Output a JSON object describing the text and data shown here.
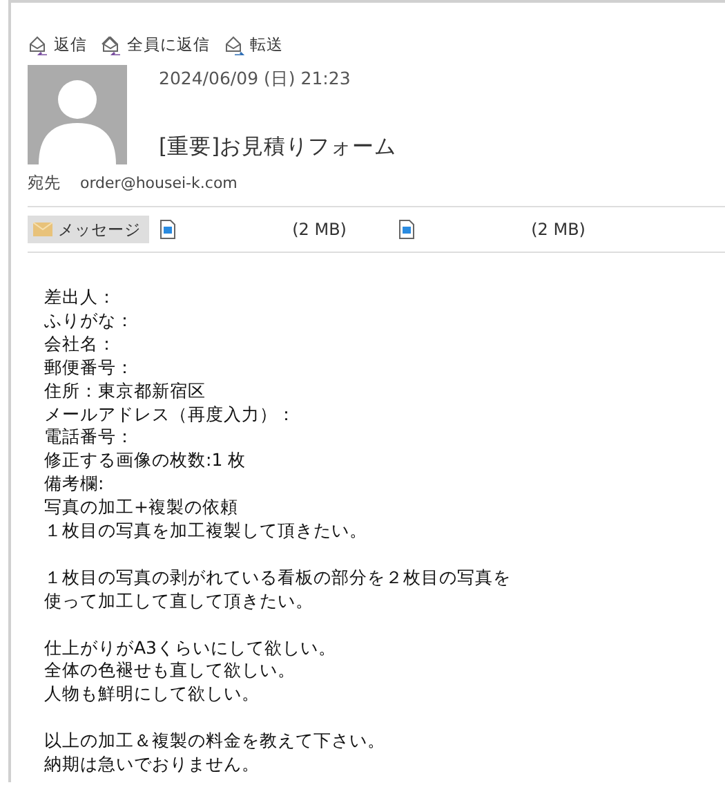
{
  "toolbar": [
    {
      "kind": "reply",
      "label": "返信"
    },
    {
      "kind": "reply-all",
      "label": "全員に返信"
    },
    {
      "kind": "forward",
      "label": "転送"
    }
  ],
  "message": {
    "date": "2024/06/09 (日) 21:23",
    "subject": "[重要]お見積りフォーム",
    "to_label": "宛先",
    "to": "order@housei-k.com"
  },
  "attachments": [
    {
      "kind": "message",
      "label": "メッセージ",
      "selected": true
    },
    {
      "kind": "file",
      "size": "(2 MB)",
      "selected": false
    },
    {
      "kind": "file",
      "size": "(2 MB)",
      "selected": false
    }
  ],
  "body": {
    "paragraphs": [
      [
        "差出人：",
        "ふりがな：",
        "会社名：",
        "郵便番号：",
        "住所：東京都新宿区",
        "メールアドレス（再度入力）：",
        "電話番号：",
        "修正する画像の枚数:1 枚",
        "備考欄:",
        "写真の加工+複製の依頼",
        "１枚目の写真を加工複製して頂きたい。"
      ],
      [
        "１枚目の写真の剥がれている看板の部分を２枚目の写真を",
        "使って加工して直して頂きたい。"
      ],
      [
        "仕上がりがA3くらいにして欲しい。",
        "全体の色褪せも直して欲しい。",
        "人物も鮮明にして欲しい。"
      ],
      [
        "以上の加工＆複製の料金を教えて下さい。",
        "納期は急いでおりません。"
      ]
    ]
  }
}
